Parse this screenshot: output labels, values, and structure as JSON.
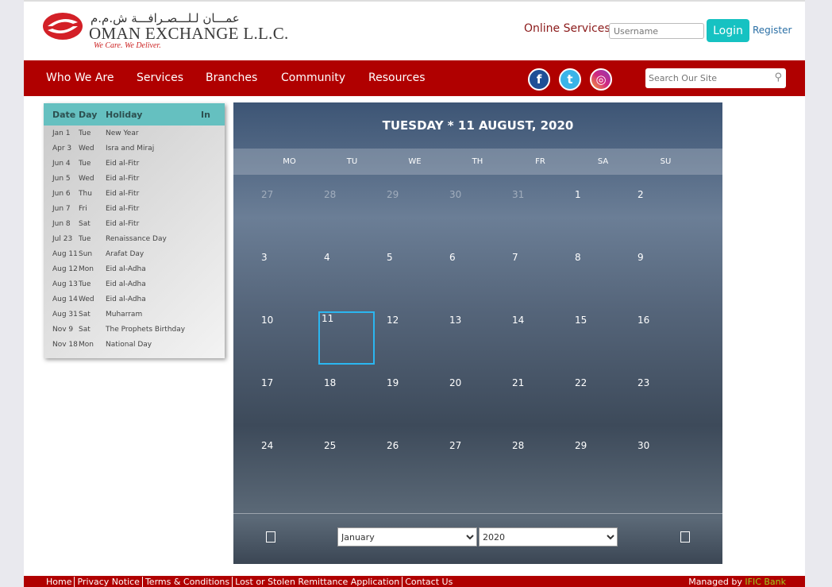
{
  "header": {
    "logo_arabic": "عمـــان لـلـــصـرافـــة ش.م.م",
    "logo_name": "OMAN EXCHANGE L.L.C.",
    "tagline": "We Care. We Deliver.",
    "online_services": "Online Services",
    "username_placeholder": "Username",
    "login": "Login",
    "register": "Register"
  },
  "nav": {
    "items": [
      "Who We Are",
      "Services",
      "Branches",
      "Community",
      "Resources"
    ],
    "social": [
      "facebook-icon",
      "twitter-icon",
      "instagram-icon"
    ],
    "search_placeholder": "Search Our Site"
  },
  "holidays": {
    "headers": [
      "Date",
      "Day",
      "Holiday",
      "In"
    ],
    "rows": [
      [
        "Jan 1",
        "Tue",
        "New Year"
      ],
      [
        "Apr 3",
        "Wed",
        "Isra and Miraj"
      ],
      [
        "Jun 4",
        "Tue",
        "Eid al-Fitr"
      ],
      [
        "Jun 5",
        "Wed",
        "Eid al-Fitr"
      ],
      [
        "Jun 6",
        "Thu",
        "Eid al-Fitr"
      ],
      [
        "Jun 7",
        "Fri",
        "Eid al-Fitr"
      ],
      [
        "Jun 8",
        "Sat",
        "Eid al-Fitr"
      ],
      [
        "Jul 23",
        "Tue",
        "Renaissance Day"
      ],
      [
        "Aug 11",
        "Sun",
        "Arafat Day"
      ],
      [
        "Aug 12",
        "Mon",
        "Eid al-Adha"
      ],
      [
        "Aug 13",
        "Tue",
        "Eid al-Adha"
      ],
      [
        "Aug 14",
        "Wed",
        "Eid al-Adha"
      ],
      [
        "Aug 31",
        "Sat",
        "Muharram"
      ],
      [
        "Nov 9",
        "Sat",
        "The Prophets Birthday"
      ],
      [
        "Nov 18",
        "Mon",
        "National Day"
      ]
    ]
  },
  "calendar": {
    "title": "TUESDAY * 11 AUGUST, 2020",
    "weekdays": [
      "MO",
      "TU",
      "WE",
      "TH",
      "FR",
      "SA",
      "SU"
    ],
    "days": [
      27,
      28,
      29,
      30,
      31,
      1,
      2,
      3,
      4,
      5,
      6,
      7,
      8,
      9,
      10,
      11,
      12,
      13,
      14,
      15,
      16,
      17,
      18,
      19,
      20,
      21,
      22,
      23,
      24,
      25,
      26,
      27,
      28,
      29,
      30
    ],
    "outside_count": 5,
    "selected": 11,
    "month": "January",
    "year": "2020",
    "accent": "#2bb6f0"
  },
  "footer": {
    "links": [
      "Home",
      "Privacy Notice",
      "Terms & Conditions",
      "Lost or Stolen Remittance Application",
      "Contact Us"
    ],
    "managed_by": "Managed by",
    "managed_link": "IFIC Bank"
  }
}
